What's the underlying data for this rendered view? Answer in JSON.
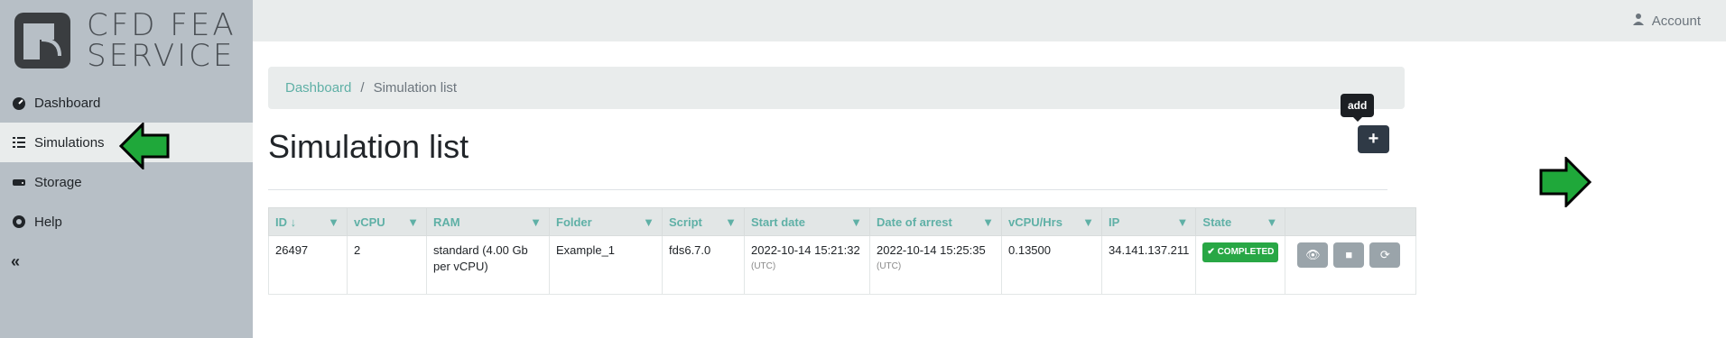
{
  "brand": {
    "line1": "CFD FEA",
    "line2": "SERVICE"
  },
  "nav": {
    "items": [
      {
        "label": "Dashboard",
        "icon": "speedometer-icon"
      },
      {
        "label": "Simulations",
        "icon": "list-check-icon"
      },
      {
        "label": "Storage",
        "icon": "drive-icon"
      },
      {
        "label": "Help",
        "icon": "lifebuoy-icon"
      }
    ],
    "collapse_label": "«"
  },
  "topbar": {
    "account_label": "Account"
  },
  "breadcrumb": {
    "root": "Dashboard",
    "sep": "/",
    "current": "Simulation list"
  },
  "page": {
    "title": "Simulation list",
    "add_tooltip": "add",
    "add_label": "+"
  },
  "table": {
    "headers": [
      "ID",
      "vCPU",
      "RAM",
      "Folder",
      "Script",
      "Start date",
      "Date of arrest",
      "vCPU/Hrs",
      "IP",
      "State",
      ""
    ],
    "rows": [
      {
        "id": "26497",
        "vcpu": "2",
        "ram": "standard (4.00 Gb per vCPU)",
        "folder": "Example_1",
        "script": "fds6.7.0",
        "start": "2022-10-14 15:21:32",
        "start_tz": "(UTC)",
        "arrest": "2022-10-14 15:25:35",
        "arrest_tz": "(UTC)",
        "vcpu_hrs": "0.13500",
        "ip": "34.141.137.211",
        "state": "COMPLETED"
      }
    ]
  },
  "colors": {
    "accent": "#5fb0a6",
    "sidebar": "#b7bfc6",
    "arrow": "#1fa83a",
    "badge": "#28a745"
  }
}
